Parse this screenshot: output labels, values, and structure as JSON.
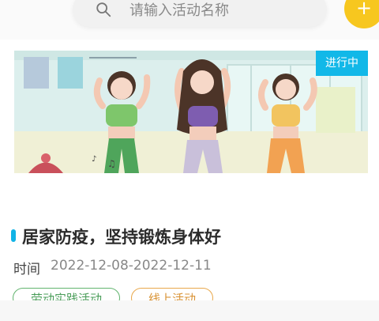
{
  "search": {
    "placeholder": "请输入活动名称"
  },
  "add_button": {
    "label": "+"
  },
  "activity": {
    "status": "进行中",
    "title": "居家防疫，坚持锻炼身体好",
    "time_label": "时间",
    "time_value": "2022-12-08-2022-12-11",
    "tags": [
      "劳动实践活动",
      "线上活动"
    ]
  },
  "colors": {
    "accent_yellow": "#f7c71f",
    "status_blue": "#12b8e8",
    "tag_green": "#62b46f",
    "tag_orange": "#e9a84b"
  }
}
